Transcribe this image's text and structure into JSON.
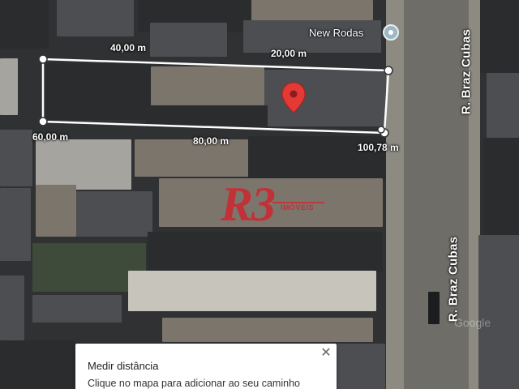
{
  "map": {
    "poi": {
      "name": "New Rodas",
      "icon": "place-marker-icon"
    },
    "streets": [
      {
        "name": "R. Braz Cubas"
      },
      {
        "name": "R. Braz Cubas"
      }
    ],
    "measurement": {
      "color": "#ffffff",
      "points": [
        "60,00 m",
        "40,00 m",
        "20,00 m",
        "80,00 m",
        "100,78 m"
      ],
      "selected_pin_color": "#e53935"
    },
    "watermark": {
      "logo": "R3",
      "sub": "IMÓVEIS",
      "color": "#d41f2a"
    },
    "provider_mark": "Google"
  },
  "panel": {
    "title": "Medir distância",
    "hint": "Clique no mapa para adicionar ao seu caminho",
    "close_icon": "close-icon"
  }
}
